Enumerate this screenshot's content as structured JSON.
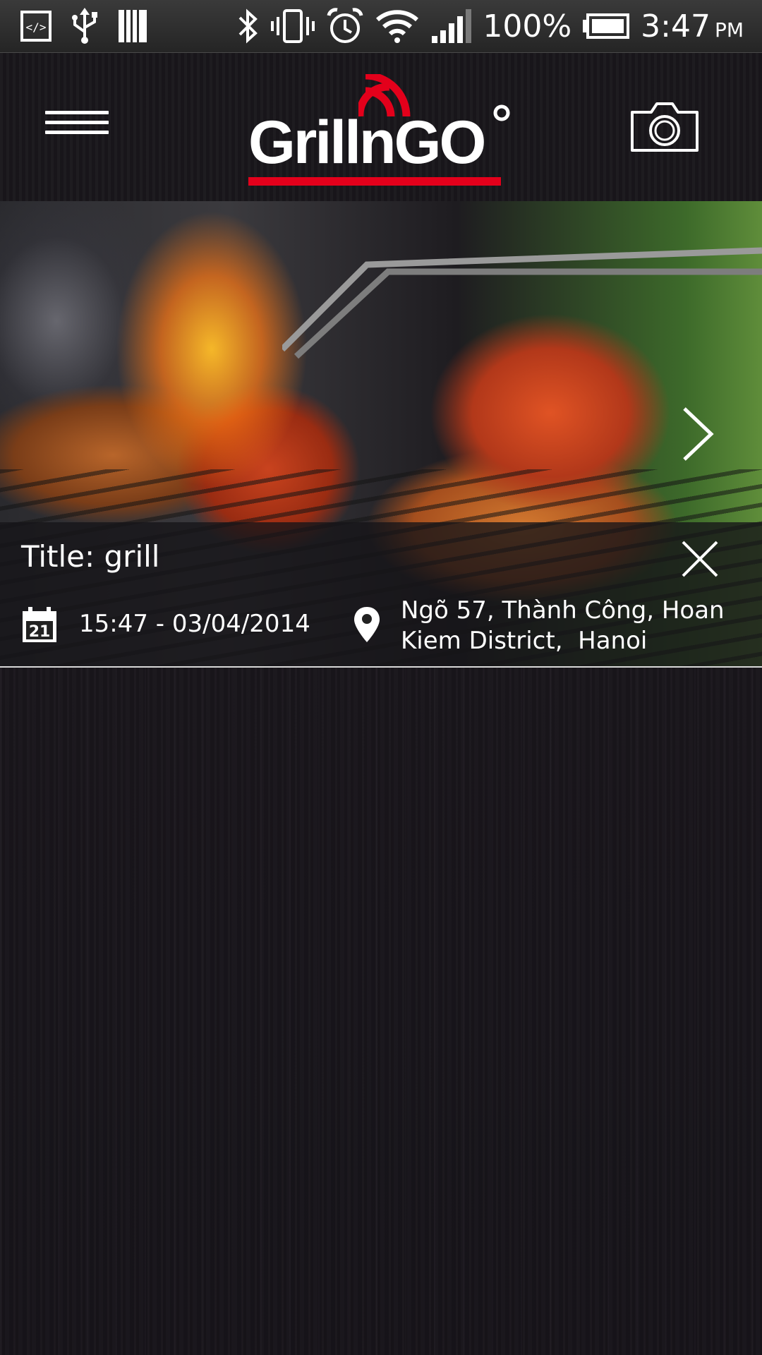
{
  "status_bar": {
    "battery": "100%",
    "time": "3:47",
    "ampm": "PM",
    "icons": [
      "debug-icon",
      "usb-icon",
      "storage-icon",
      "bluetooth-icon",
      "vibrate-icon",
      "alarm-icon",
      "wifi-icon",
      "signal-icon",
      "battery-icon"
    ]
  },
  "header": {
    "logo_text": "GrillnGO",
    "brand_color": "#e3001b",
    "icons": [
      "menu-icon",
      "camera-icon"
    ]
  },
  "post": {
    "title": "Title: grill",
    "datetime": "15:47 - 03/04/2014",
    "calendar_day": "21",
    "address_line1": "Ngõ 57, Thành Công, Hoan",
    "address_line2": "Kiem District,  Hanoi",
    "icons": [
      "calendar-icon",
      "location-pin-icon",
      "close-icon",
      "chevron-right-icon"
    ]
  }
}
